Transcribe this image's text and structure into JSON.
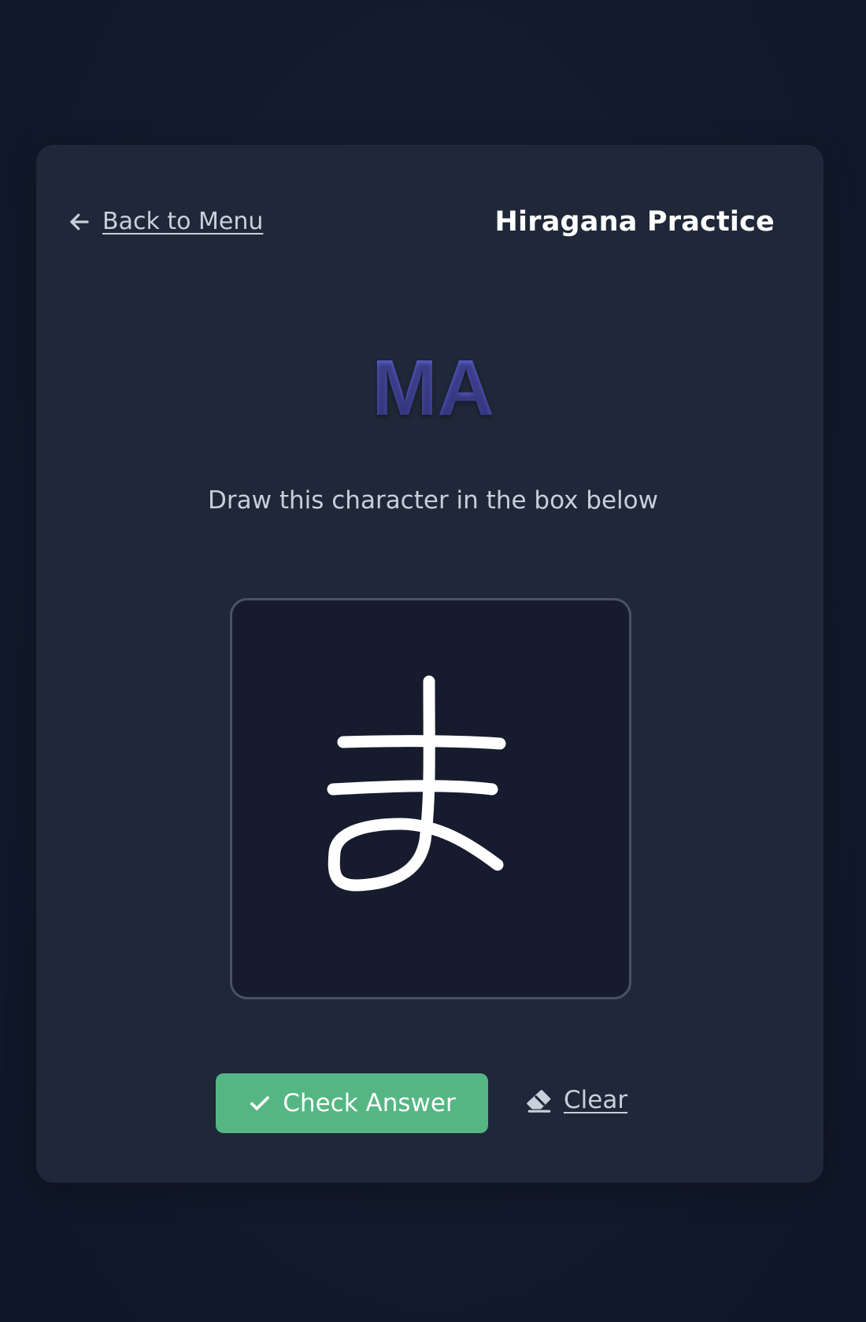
{
  "header": {
    "back_label": "Back to Menu",
    "back_icon": "arrow-left-icon",
    "title": "Hiragana Practice"
  },
  "prompt": {
    "romaji": "MA",
    "instruction": "Draw this character in the box below"
  },
  "drawing": {
    "drawn_character": "ま",
    "stroke_color": "#ffffff",
    "background_color": "#161c2d"
  },
  "actions": {
    "check_label": "Check Answer",
    "check_icon": "check-icon",
    "clear_label": "Clear",
    "clear_icon": "eraser-icon"
  },
  "colors": {
    "accent": "#5b5fcf",
    "success": "#55b684",
    "card": "#1f2838",
    "page": "#121a2c"
  }
}
